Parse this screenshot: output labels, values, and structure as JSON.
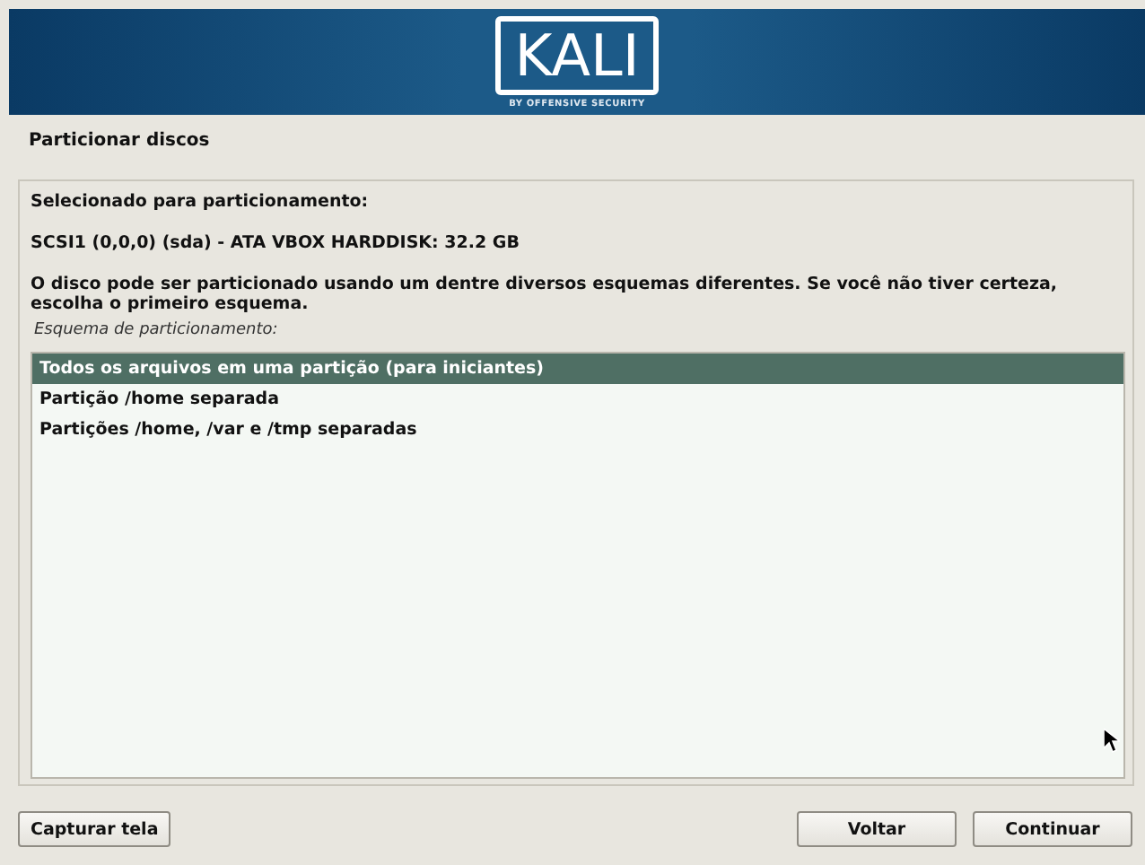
{
  "banner": {
    "logo": "KALI",
    "tagline": "BY OFFENSIVE SECURITY"
  },
  "title": "Particionar discos",
  "heading": "Selecionado para particionamento:",
  "disk": "SCSI1 (0,0,0) (sda) - ATA VBOX HARDDISK: 32.2 GB",
  "description": "O disco pode ser particionado usando um dentre diversos esquemas diferentes. Se você não tiver certeza, escolha o primeiro esquema.",
  "list_label": "Esquema de particionamento:",
  "options": [
    {
      "label": "Todos os arquivos em uma partição (para iniciantes)",
      "selected": true
    },
    {
      "label": "Partição /home separada",
      "selected": false
    },
    {
      "label": "Partições /home, /var e /tmp separadas",
      "selected": false
    }
  ],
  "buttons": {
    "left": [
      "Capturar tela"
    ],
    "right": [
      "Voltar",
      "Continuar"
    ]
  }
}
